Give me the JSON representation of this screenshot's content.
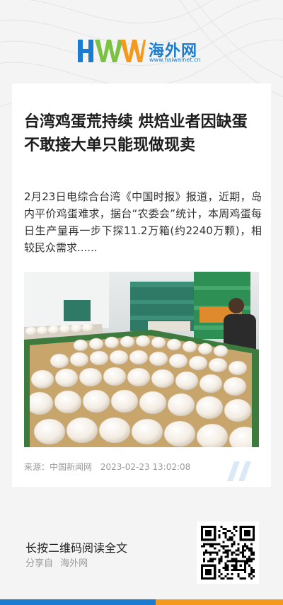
{
  "brand": {
    "logo_latin": "HWW",
    "logo_cn": "海外网",
    "url": "www.haiwainet.cn",
    "colors": {
      "blue": "#1a7bd0",
      "orange": "#f39a1e",
      "green": "#7cc242"
    }
  },
  "article": {
    "title": "台湾鸡蛋荒持续 烘焙业者因缺蛋不敢接大单只能现做现卖",
    "summary": "2月23日电综合台湾《中国时报》报道，近期，岛内平价鸡蛋难求，据台“农委会”统计，本周鸡蛋每日生产量再一步下探11.2万箱(约2240万颗)，相较民众需求......",
    "source": "来源：中国新闻网",
    "datetime": "2023-02-23 13:02:08",
    "photo_icon": "egg-crates-photo"
  },
  "footer": {
    "cta": "长按二维码阅读全文",
    "share_prefix": "分享自",
    "share_site": "海外网",
    "qr_icon": "qr-code-icon"
  }
}
